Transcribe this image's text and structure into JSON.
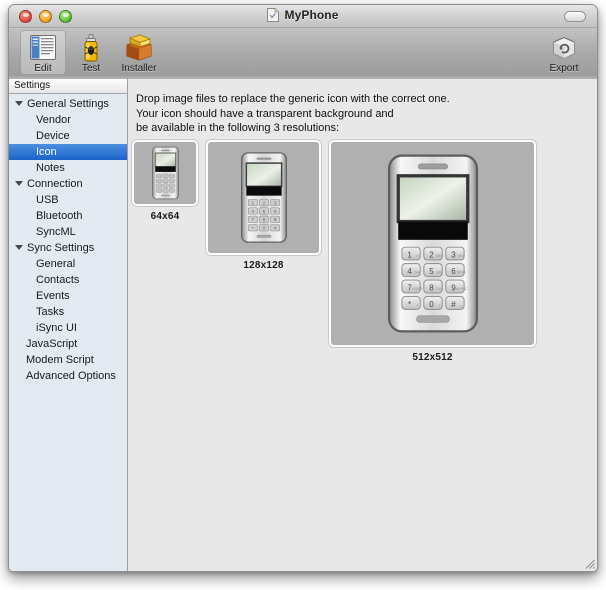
{
  "window": {
    "title": "MyPhone",
    "proxy_icon": "document-icon",
    "controls": {
      "close": "close-button",
      "minimize": "minimize-button",
      "zoom": "zoom-button",
      "toolbar_toggle": "toolbar-toggle-button"
    },
    "resize_grip": "resize-grip"
  },
  "toolbar": {
    "items": [
      {
        "label": "Edit",
        "icon": "edit-document-icon",
        "selected": true
      },
      {
        "label": "Test",
        "icon": "spray-can-bug-icon",
        "selected": false
      },
      {
        "label": "Installer",
        "icon": "package-box-icon",
        "selected": false
      }
    ],
    "export": {
      "label": "Export",
      "icon": "export-box-icon"
    }
  },
  "sidebar": {
    "header": "Settings",
    "items": [
      {
        "label": "General Settings",
        "level": "group",
        "expanded": true,
        "selected": false
      },
      {
        "label": "Vendor",
        "level": "child",
        "selected": false
      },
      {
        "label": "Device",
        "level": "child",
        "selected": false
      },
      {
        "label": "Icon",
        "level": "child",
        "selected": true
      },
      {
        "label": "Notes",
        "level": "child",
        "selected": false
      },
      {
        "label": "Connection",
        "level": "group",
        "expanded": true,
        "selected": false
      },
      {
        "label": "USB",
        "level": "child",
        "selected": false
      },
      {
        "label": "Bluetooth",
        "level": "child",
        "selected": false
      },
      {
        "label": "SyncML",
        "level": "child",
        "selected": false
      },
      {
        "label": "Sync Settings",
        "level": "group",
        "expanded": true,
        "selected": false
      },
      {
        "label": "General",
        "level": "child",
        "selected": false
      },
      {
        "label": "Contacts",
        "level": "child",
        "selected": false
      },
      {
        "label": "Events",
        "level": "child",
        "selected": false
      },
      {
        "label": "Tasks",
        "level": "child",
        "selected": false
      },
      {
        "label": "iSync UI",
        "level": "child",
        "selected": false
      },
      {
        "label": "JavaScript",
        "level": "flat",
        "selected": false
      },
      {
        "label": "Modem Script",
        "level": "flat",
        "selected": false
      },
      {
        "label": "Advanced Options",
        "level": "flat",
        "selected": false
      }
    ]
  },
  "main": {
    "instructions": [
      "Drop image files to replace the generic icon with the correct one.",
      "Your icon should have a transparent background and",
      "be available in the following 3 resolutions:"
    ],
    "icon_zones": [
      {
        "label": "64x64",
        "icon": "phone-icon"
      },
      {
        "label": "128x128",
        "icon": "phone-icon"
      },
      {
        "label": "512x512",
        "icon": "phone-icon"
      }
    ],
    "phone_keypad": [
      [
        "1",
        "2",
        "3"
      ],
      [
        "4",
        "5",
        "6"
      ],
      [
        "7",
        "8",
        "9"
      ],
      [
        "*",
        "0",
        "#"
      ]
    ]
  },
  "colors": {
    "selection_blue": "#1b63cb",
    "sidebar_bg": "#e3eaf2",
    "content_bg": "#e8e8e8",
    "dropzone_fill": "#b0b0b0"
  }
}
